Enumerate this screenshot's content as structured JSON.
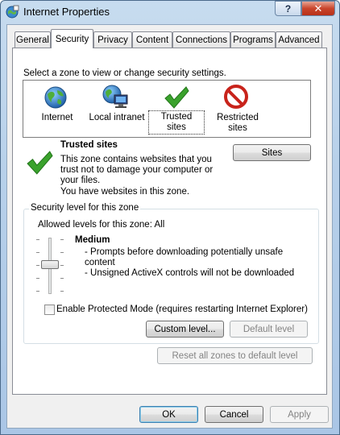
{
  "window": {
    "title": "Internet Properties",
    "help_glyph": "?",
    "close_glyph": "✕"
  },
  "tabs": [
    "General",
    "Security",
    "Privacy",
    "Content",
    "Connections",
    "Programs",
    "Advanced"
  ],
  "zone_prompt": "Select a zone to view or change security settings.",
  "zones": [
    {
      "label": "Internet",
      "icon": "globe-icon"
    },
    {
      "label": "Local intranet",
      "icon": "intranet-icon"
    },
    {
      "label": "Trusted sites",
      "icon": "checkmark-icon",
      "selected": true
    },
    {
      "label": "Restricted sites",
      "icon": "restricted-icon"
    }
  ],
  "zone_info": {
    "title": "Trusted sites",
    "desc_line1": "This zone contains websites that you",
    "desc_line2": "trust not to damage your computer or",
    "desc_line3": "your files.",
    "desc_line4": "You have websites in this zone.",
    "sites_button": "Sites"
  },
  "security_level": {
    "group_label": "Security level for this zone",
    "allowed": "Allowed levels for this zone: All",
    "level_name": "Medium",
    "bullet1a": "- Prompts before downloading potentially unsafe",
    "bullet1b": "content",
    "bullet2": "- Unsigned ActiveX controls will not be downloaded",
    "slider_level": 0.5
  },
  "protected_mode": {
    "label": "Enable Protected Mode (requires restarting Internet Explorer)",
    "checked": false
  },
  "buttons": {
    "custom_level": "Custom level...",
    "default_level": "Default level",
    "reset_all": "Reset all zones to default level",
    "ok": "OK",
    "cancel": "Cancel",
    "apply": "Apply"
  },
  "colors": {
    "accent_green": "#3aa22c",
    "restricted_red": "#c8231b",
    "globe_blue": "#2d7fc9"
  }
}
